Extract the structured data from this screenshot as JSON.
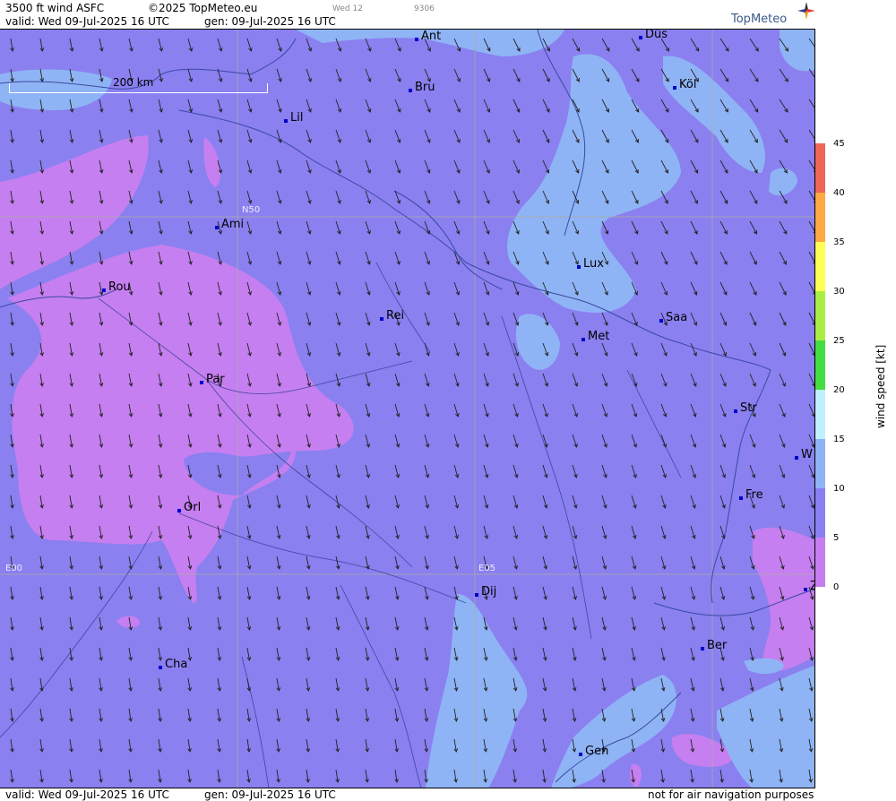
{
  "header": {
    "product": "3500 ft wind ASFC",
    "copyright": "©2025 TopMeteo.eu",
    "tab_day": "Wed 12",
    "tab_code": "9306",
    "valid": "valid:  Wed  09-Jul-2025  16 UTC",
    "generated": "gen: 09-Jul-2025 16 UTC",
    "brand": "TopMeteo"
  },
  "map": {
    "scale_label": "200 km",
    "grid_labels": {
      "lat": "N50",
      "lon_west": "E00",
      "lon_east": "E05"
    },
    "cities": [
      {
        "name": "Ant"
      },
      {
        "name": "Düs"
      },
      {
        "name": "Köl"
      },
      {
        "name": "Bru"
      },
      {
        "name": "Lil"
      },
      {
        "name": "Ami"
      },
      {
        "name": "Rou"
      },
      {
        "name": "Lux"
      },
      {
        "name": "Rei"
      },
      {
        "name": "Saa"
      },
      {
        "name": "Met"
      },
      {
        "name": "Par"
      },
      {
        "name": "Str"
      },
      {
        "name": "W"
      },
      {
        "name": "Fre"
      },
      {
        "name": "Orl"
      },
      {
        "name": "Dij"
      },
      {
        "name": "Z"
      },
      {
        "name": "Ber"
      },
      {
        "name": "Cha"
      },
      {
        "name": "Gen"
      }
    ]
  },
  "legend": {
    "title": "wind  speed  [kt]",
    "ticks": [
      "45",
      "40",
      "35",
      "30",
      "25",
      "20",
      "15",
      "10",
      "5",
      "0"
    ],
    "colors": {
      "c0_5": "#c57ff0",
      "c5_10": "#8a80f0",
      "c10_15": "#8fb4f5",
      "c15_20": "#bff0ff",
      "c20_25": "#44dd44",
      "c25_30": "#aaee44",
      "c30_35": "#ffff55",
      "c35_40": "#ffaa44",
      "c40_45": "#ee6655"
    }
  },
  "footer": {
    "valid": "valid:  Wed  09-Jul-2025  16 UTC",
    "generated": "gen: 09-Jul-2025 16 UTC",
    "disclaimer": "not for air navigation purposes"
  }
}
